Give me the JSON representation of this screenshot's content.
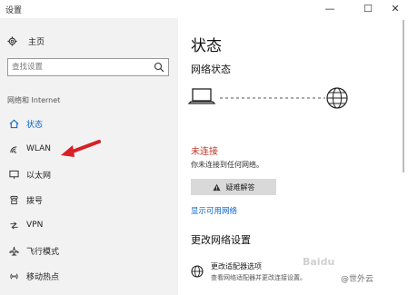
{
  "window": {
    "title": "设置",
    "minimize": "—",
    "maximize": "☐",
    "close": "✕"
  },
  "sidebar": {
    "home_label": "主页",
    "search_placeholder": "查找设置",
    "section_label": "网络和 Internet",
    "items": [
      {
        "label": "状态",
        "icon": "home-status-icon",
        "active": true
      },
      {
        "label": "WLAN",
        "icon": "wifi-icon",
        "active": false
      },
      {
        "label": "以太网",
        "icon": "ethernet-icon",
        "active": false
      },
      {
        "label": "拨号",
        "icon": "phone-icon",
        "active": false
      },
      {
        "label": "VPN",
        "icon": "vpn-icon",
        "active": false
      },
      {
        "label": "飞行模式",
        "icon": "airplane-icon",
        "active": false
      },
      {
        "label": "移动热点",
        "icon": "hotspot-icon",
        "active": false
      }
    ]
  },
  "main": {
    "title": "状态",
    "network_status_heading": "网络状态",
    "connection_status": "未连接",
    "connection_desc": "你未连接到任何网络。",
    "troubleshoot_label": "疑难解答",
    "show_networks_link": "显示可用网络",
    "change_settings_heading": "更改网络设置",
    "adapter_title": "更改适配器选项",
    "adapter_desc": "查看网络适配器并更改连接设置。"
  },
  "watermark": {
    "text": "@世外云",
    "faint_text": "Baidu"
  },
  "colors": {
    "accent": "#0a63c9",
    "error": "#c0392b",
    "sidebar_bg": "#f2f2f2",
    "arrow": "#d91f26"
  }
}
